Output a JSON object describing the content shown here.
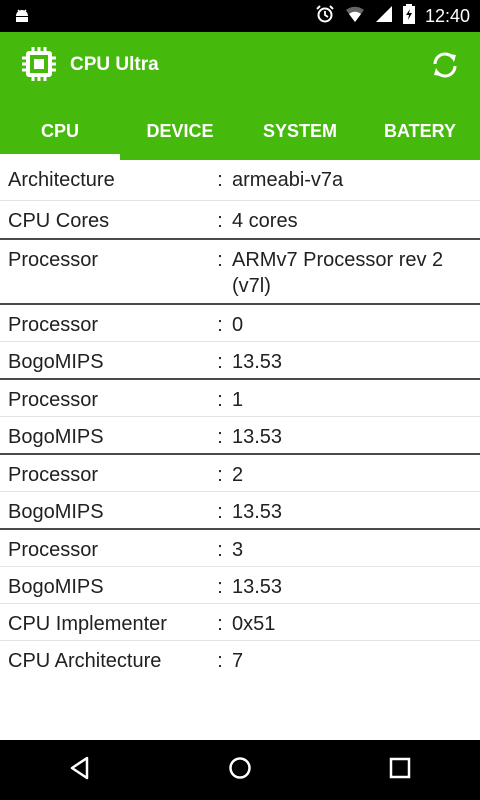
{
  "status_bar": {
    "time": "12:40"
  },
  "app": {
    "title": "CPU Ultra"
  },
  "tabs": [
    {
      "label": "CPU",
      "active": true
    },
    {
      "label": "DEVICE",
      "active": false
    },
    {
      "label": "SYSTEM",
      "active": false
    },
    {
      "label": "BATERY",
      "active": false
    }
  ],
  "separator": ":",
  "rows": [
    {
      "label": "Architecture",
      "value": "armeabi-v7a"
    },
    {
      "label": "CPU Cores",
      "value": "4 cores"
    },
    {
      "label": "Processor",
      "value": "ARMv7 Processor rev 2 (v7l)"
    },
    {
      "label": "Processor",
      "value": "0"
    },
    {
      "label": "BogoMIPS",
      "value": "13.53"
    },
    {
      "label": "Processor",
      "value": "1"
    },
    {
      "label": "BogoMIPS",
      "value": "13.53"
    },
    {
      "label": "Processor",
      "value": "2"
    },
    {
      "label": "BogoMIPS",
      "value": "13.53"
    },
    {
      "label": "Processor",
      "value": "3"
    },
    {
      "label": "BogoMIPS",
      "value": "13.53"
    },
    {
      "label": "CPU Implementer",
      "value": "0x51"
    },
    {
      "label": "CPU Architecture",
      "value": "7"
    }
  ],
  "colors": {
    "accent": "#45b90c",
    "status_bar": "#000000",
    "nav_bar": "#000000"
  }
}
